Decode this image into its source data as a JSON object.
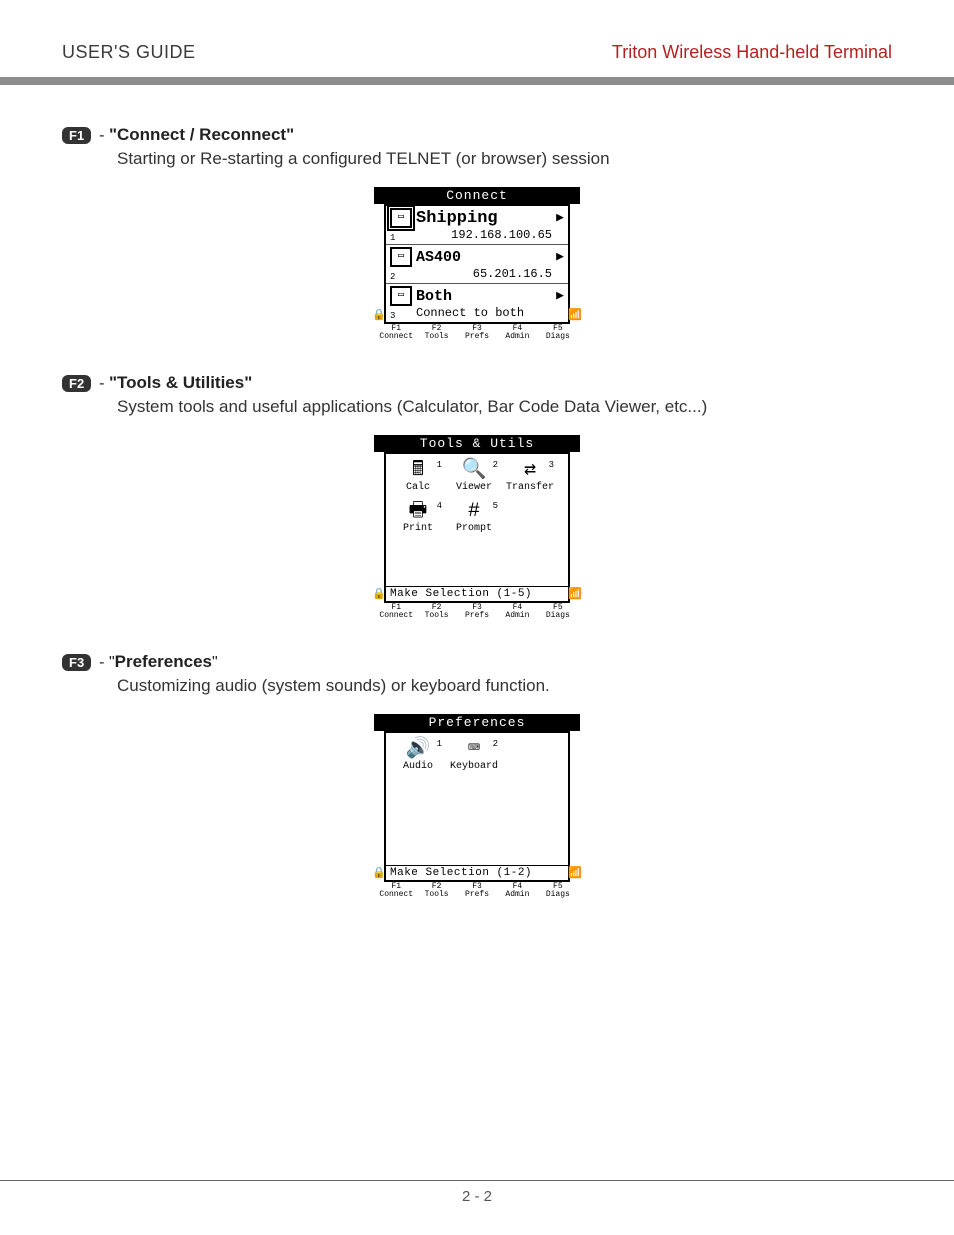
{
  "header": {
    "left": "USER'S GUIDE",
    "right": "Triton Wireless Hand-held Terminal"
  },
  "sections": [
    {
      "fkey": "F1",
      "dash": " - ",
      "quote_open": "\"",
      "title": "Connect / Reconnect",
      "quote_close": "\"",
      "desc": "Starting or Re-starting a configured TELNET (or browser) session"
    },
    {
      "fkey": "F2",
      "dash": " - ",
      "quote_open": "\"",
      "title": "Tools & Utilities",
      "quote_close": "\"",
      "desc": "System tools and useful applications (Calculator, Bar Code Data Viewer, etc...)"
    },
    {
      "fkey": "F3",
      "dash": " - ",
      "quote_open": "\"",
      "title": "Preferences",
      "quote_close": "\"",
      "desc": "Customizing audio (system sounds) or keyboard function."
    }
  ],
  "softkeys": {
    "f1top": "F1",
    "f1": "Connect",
    "f2top": "F2",
    "f2": "Tools",
    "f3top": "F3",
    "f3": "Prefs",
    "f4top": "F4",
    "f4": "Admin",
    "f5top": "F5",
    "f5": "Diags"
  },
  "side_icons": {
    "left": "🔒",
    "right": "📶"
  },
  "screens": {
    "connect": {
      "title": "Connect",
      "rows": [
        {
          "num": "1",
          "name": "Shipping",
          "sub": "192.168.100.65",
          "selected": true
        },
        {
          "num": "2",
          "name": "AS400",
          "sub": "65.201.16.5",
          "selected": false
        },
        {
          "num": "3",
          "name": "Both",
          "sub": "Connect to both",
          "selected": false
        }
      ]
    },
    "tools": {
      "title": "Tools & Utils",
      "status": "Make Selection (1-5)",
      "cells": [
        {
          "num": "1",
          "glyph": "🖩",
          "label": "Calc"
        },
        {
          "num": "2",
          "glyph": "🔍",
          "label": "Viewer"
        },
        {
          "num": "3",
          "glyph": "⇄",
          "label": "Transfer"
        },
        {
          "num": "4",
          "glyph": "🖶",
          "label": "Print"
        },
        {
          "num": "5",
          "glyph": "#",
          "label": "Prompt"
        }
      ]
    },
    "prefs": {
      "title": "Preferences",
      "status": "Make Selection (1-2)",
      "cells": [
        {
          "num": "1",
          "glyph": "🔊",
          "label": "Audio"
        },
        {
          "num": "2",
          "glyph": "⌨",
          "label": "Keyboard"
        }
      ]
    }
  },
  "footer": {
    "page": "2 - 2"
  }
}
